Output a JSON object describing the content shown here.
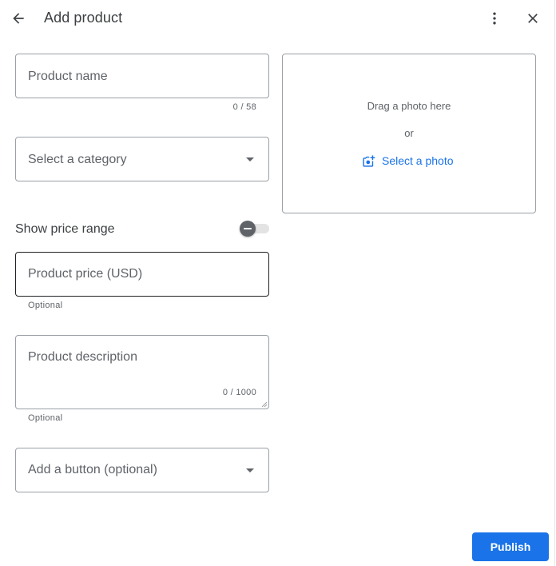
{
  "header": {
    "title": "Add product",
    "back_icon": "arrow-back-icon",
    "more_icon": "more-vert-icon",
    "close_icon": "close-icon"
  },
  "form": {
    "product_name": {
      "placeholder": "Product name",
      "value": "",
      "counter": "0 / 58"
    },
    "category": {
      "placeholder": "Select a category",
      "selected": "",
      "icon": "dropdown-caret-icon"
    },
    "price_range_toggle": {
      "label": "Show price range",
      "on": false
    },
    "product_price": {
      "placeholder": "Product price (USD)",
      "value": "",
      "helper": "Optional"
    },
    "description": {
      "placeholder": "Product description",
      "value": "",
      "counter": "0 / 1000",
      "helper": "Optional"
    },
    "add_button": {
      "placeholder": "Add a button (optional)",
      "selected": "",
      "icon": "dropdown-caret-icon"
    }
  },
  "photo": {
    "drag_text": "Drag a photo here",
    "or_text": "or",
    "select_label": "Select a photo",
    "select_icon": "add-photo-icon"
  },
  "actions": {
    "publish_label": "Publish"
  },
  "colors": {
    "accent": "#1a73e8",
    "text_primary": "#3c4043",
    "text_secondary": "#5f6368",
    "outline": "#9aa0a6"
  }
}
